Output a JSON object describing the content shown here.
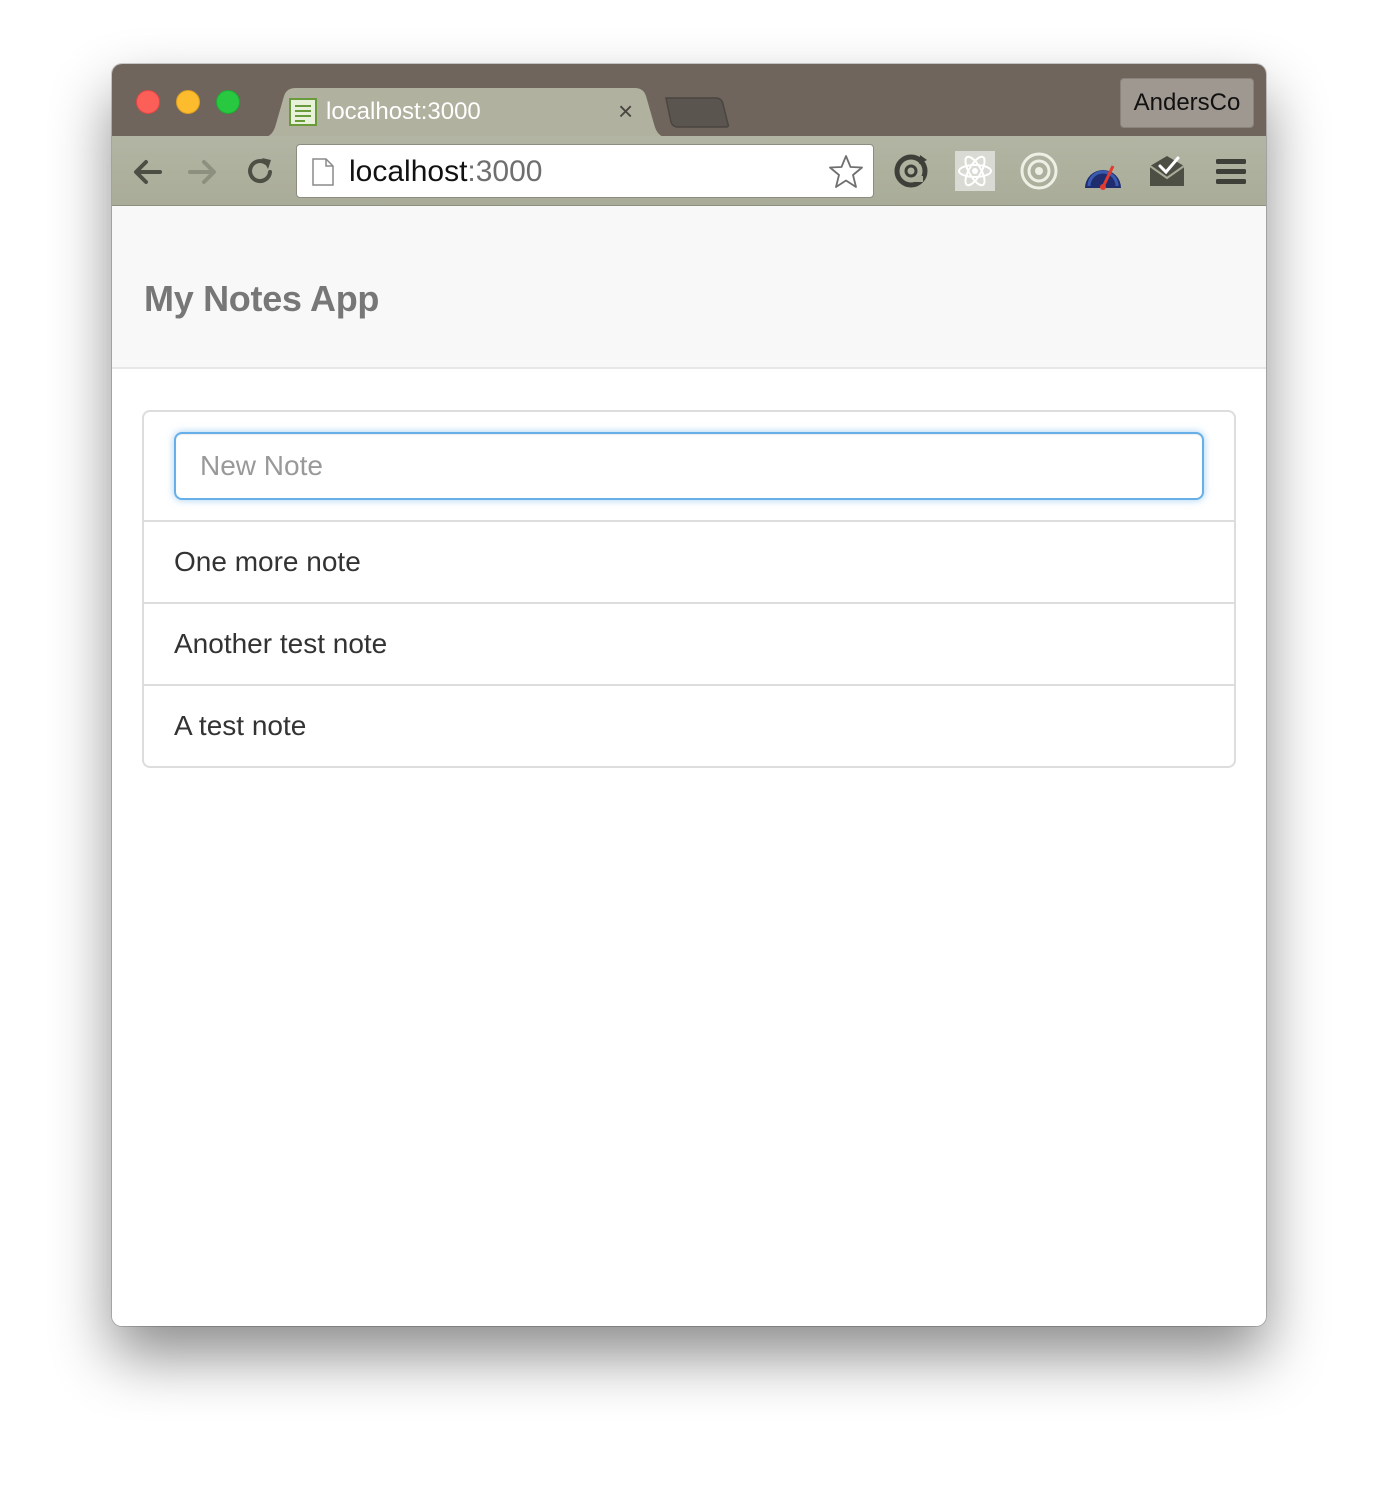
{
  "browser": {
    "tab_title": "localhost:3000",
    "tab_close": "×",
    "profile_name": "AndersCo",
    "address_host": "localhost",
    "address_port": ":3000"
  },
  "app": {
    "brand": "My Notes App",
    "new_note_placeholder": "New Note",
    "new_note_value": "",
    "notes": [
      "One more note",
      "Another test note",
      "A test note"
    ]
  },
  "colors": {
    "tabstrip": "#6f655d",
    "toolbar": "#b2b5a3",
    "navbar": "#f8f8f8",
    "input_focus": "#66afe9"
  },
  "icons": {
    "extensions": [
      "sync-icon",
      "react-icon",
      "target-icon",
      "speedometer-icon",
      "mail-check-icon"
    ],
    "menu": "hamburger-menu-icon"
  }
}
